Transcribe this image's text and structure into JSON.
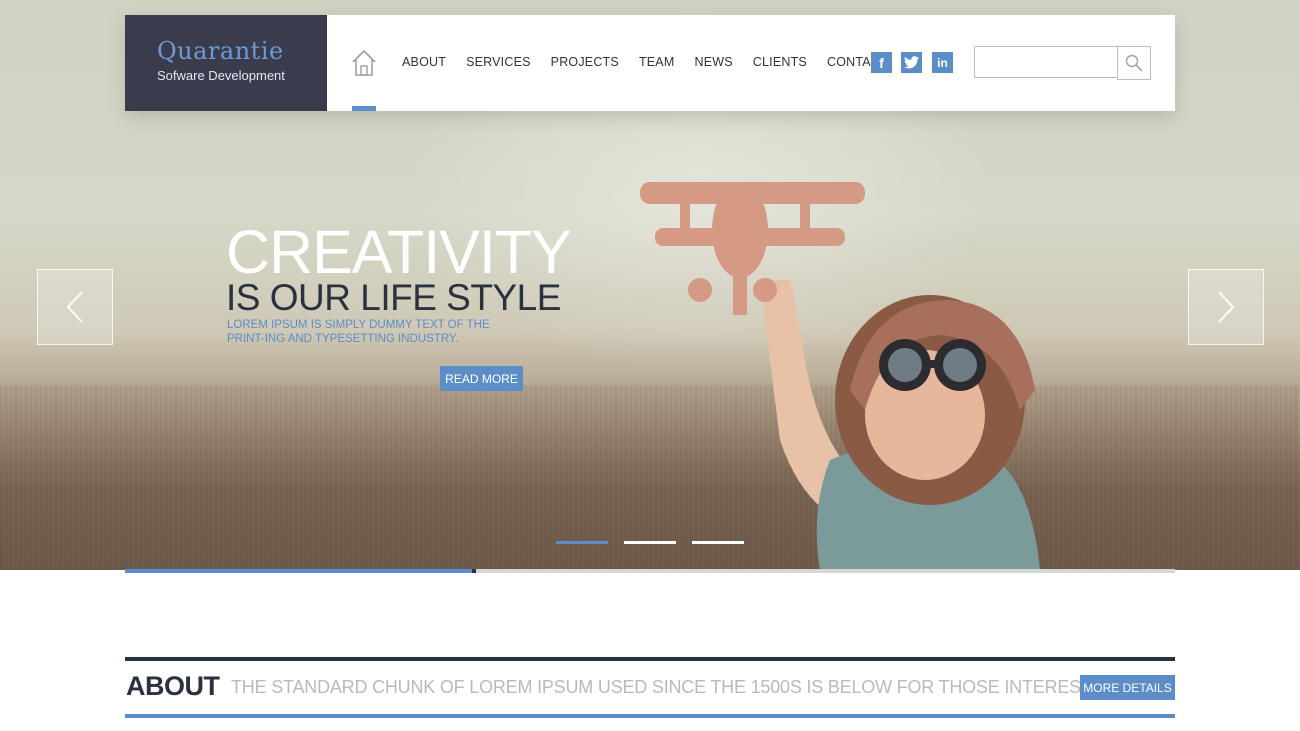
{
  "brand": {
    "name": "Quarantie",
    "tagline": "Sofware Development"
  },
  "nav": {
    "items": [
      "ABOUT",
      "SERVICES",
      "PROJECTS",
      "TEAM",
      "NEWS",
      "CLIENTS",
      "CONTACT"
    ]
  },
  "social": {
    "facebook": "f",
    "twitter": "t",
    "linkedin": "in"
  },
  "search": {
    "value": "",
    "placeholder": ""
  },
  "hero": {
    "headline": "CREATIVITY",
    "subheadline": "IS OUR LIFE STYLE",
    "description": "LOREM IPSUM IS SIMPLY DUMMY TEXT OF THE PRINT-ING AND TYPESETTING INDUSTRY.",
    "cta_label": "READ MORE",
    "slides_total": 3,
    "active_slide": 1,
    "progress": 0.33
  },
  "about": {
    "title": "ABOUT",
    "text": "THE STANDARD CHUNK OF LOREM IPSUM USED SINCE THE 1500S IS BELOW FOR THOSE INTERESTED.",
    "button_label": "MORE DETAILS"
  },
  "colors": {
    "accent": "#5b8ec8",
    "dark": "#2c3140",
    "logo_bg": "#3a3c4e"
  },
  "icons": {
    "home": "home-icon",
    "search": "search-icon",
    "prev": "chevron-left-icon",
    "next": "chevron-right-icon"
  }
}
